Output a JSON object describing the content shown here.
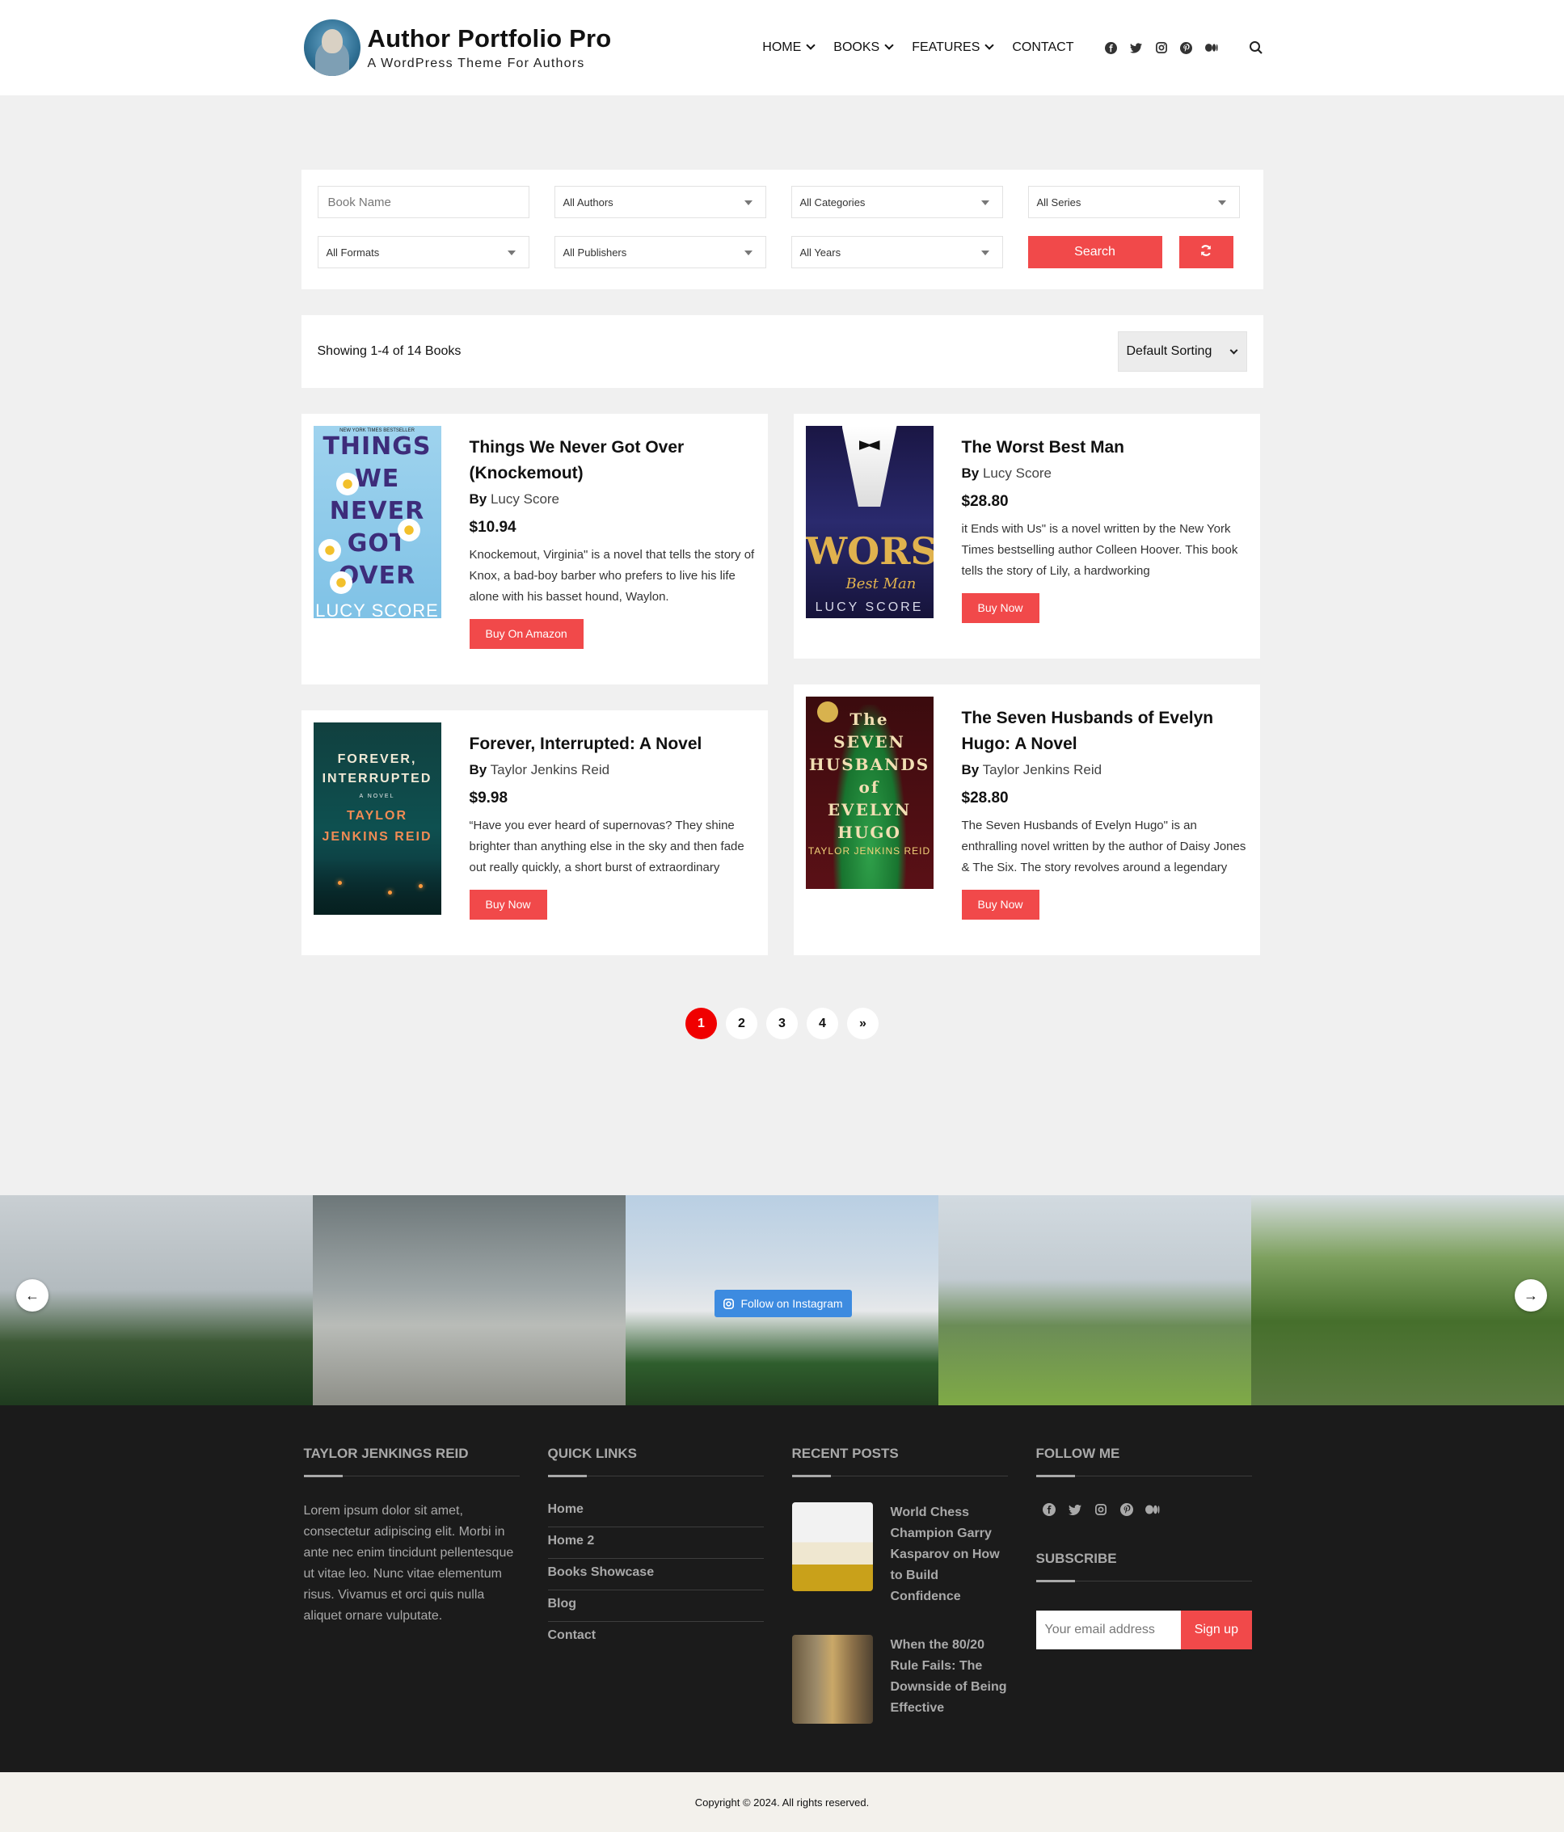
{
  "brand": {
    "title": "Author Portfolio Pro",
    "tagline": "A WordPress Theme For Authors"
  },
  "nav": {
    "items": [
      {
        "label": "HOME",
        "dropdown": true
      },
      {
        "label": "BOOKS",
        "dropdown": true
      },
      {
        "label": "FEATURES",
        "dropdown": true
      },
      {
        "label": "CONTACT",
        "dropdown": false
      }
    ],
    "social_icons": [
      "facebook-icon",
      "twitter-icon",
      "instagram-icon",
      "pinterest-icon",
      "medium-icon"
    ],
    "search_icon": "search-icon"
  },
  "filters": {
    "book_name_placeholder": "Book Name",
    "authors": "All Authors",
    "categories": "All Categories",
    "series": "All Series",
    "formats": "All Formats",
    "publishers": "All Publishers",
    "years": "All Years",
    "search_label": "Search",
    "reset_icon": "refresh-icon"
  },
  "results": {
    "count_text": "Showing 1-4 of 14 Books",
    "sort_value": "Default Sorting"
  },
  "books": [
    {
      "title": "Things We Never Got Over (Knockemout)",
      "by_label": "By",
      "author": "Lucy Score",
      "price": "$10.94",
      "description": "Knockemout, Virginia\" is a novel that tells the story of Knox, a bad-boy barber who prefers to live his life alone with his basset hound, Waylon.",
      "button": "Buy On Amazon",
      "cover": {
        "top": "NEW YORK TIMES BESTSELLER",
        "lines": [
          "THINGS",
          "WE",
          "NEVER",
          "GOT",
          "OVER"
        ],
        "author": "LUCY SCORE"
      }
    },
    {
      "title": "The Worst Best Man",
      "by_label": "By",
      "author": "Lucy Score",
      "price": "$28.80",
      "description": "it Ends with Us\" is a novel written by the New York Times bestselling author Colleen Hoover. This book tells the story of Lily, a hardworking",
      "button": "Buy Now",
      "cover": {
        "line1": "WORST",
        "line2": "Best Man",
        "author": "LUCY SCORE"
      }
    },
    {
      "title": "Forever, Interrupted: A Novel",
      "by_label": "By",
      "author": "Taylor Jenkins Reid",
      "price": "$9.98",
      "description": "“Have you ever heard of supernovas? They shine brighter than anything else in the sky and then fade out really quickly, a short burst of extraordinary",
      "button": "Buy Now",
      "cover": {
        "line1": "FOREVER,",
        "line2": "INTERRUPTED",
        "novel": "A NOVEL",
        "author1": "TAYLOR",
        "author2": "JENKINS REID"
      }
    },
    {
      "title": "The Seven Husbands of Evelyn Hugo: A Novel",
      "by_label": "By",
      "author": "Taylor Jenkins Reid",
      "price": "$28.80",
      "description": "The Seven Husbands of Evelyn Hugo\" is an enthralling novel written by the author of Daisy Jones & The Six. The story revolves around a legendary",
      "button": "Buy Now",
      "cover": {
        "lines": [
          "The",
          "SEVEN",
          "HUSBANDS",
          "of",
          "EVELYN",
          "HUGO"
        ],
        "author": "TAYLOR JENKINS REID"
      }
    }
  ],
  "pagination": {
    "pages": [
      "1",
      "2",
      "3",
      "4",
      "»"
    ],
    "active": "1"
  },
  "instagram": {
    "follow_label": "Follow on Instagram",
    "prev_arrow": "←",
    "next_arrow": "→"
  },
  "footer": {
    "about": {
      "heading": "TAYLOR JENKINGS REID",
      "text": "Lorem ipsum dolor sit amet, consectetur adipiscing elit. Morbi in ante nec enim tincidunt pellentesque ut vitae leo. Nunc vitae elementum risus. Vivamus et orci quis nulla aliquet ornare vulputate."
    },
    "quick_links": {
      "heading": "QUICK LINKS",
      "items": [
        "Home",
        "Home 2",
        "Books Showcase",
        "Blog",
        "Contact"
      ]
    },
    "recent_posts": {
      "heading": "RECENT POSTS",
      "items": [
        "World Chess Champion Garry Kasparov on How to Build Confidence",
        "When the 80/20 Rule Fails: The Downside of Being Effective"
      ]
    },
    "follow": {
      "heading": "FOLLOW ME"
    },
    "subscribe": {
      "heading": "SUBSCRIBE",
      "placeholder": "Your email address",
      "button": "Sign up"
    },
    "copyright": "Copyright © 2024. All rights reserved."
  },
  "colors": {
    "accent": "#f1494a",
    "pager_active": "#f00000",
    "footer_bg": "#1b1b1b",
    "instagram_button": "#3d8be0"
  }
}
